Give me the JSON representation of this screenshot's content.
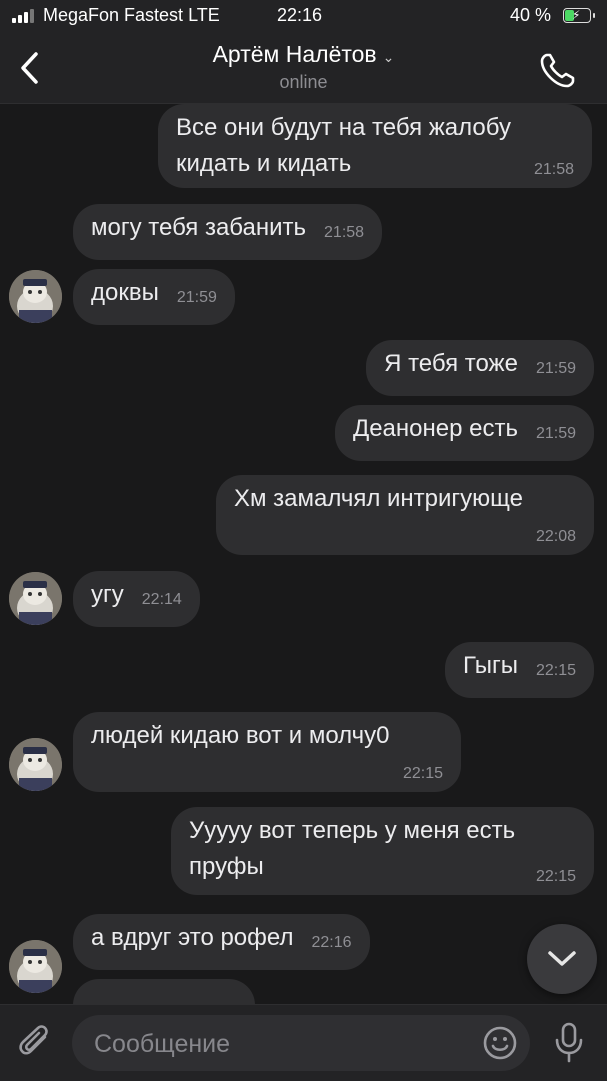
{
  "status_bar": {
    "carrier": "MegaFon Fastest LTE",
    "time": "22:16",
    "battery_percent": "40 %",
    "battery_level": 0.4
  },
  "header": {
    "name": "Артём Налётов",
    "status": "online",
    "icons": {
      "back": "chevron-left-icon",
      "dropdown": "chevron-down-icon",
      "call": "phone-icon"
    }
  },
  "messages": [
    {
      "direction": "out",
      "text": "Все они будут на тебя жалобу кидать и кидать",
      "line1": "Все они будут на тебя жалобу",
      "line2": "кидать и кидать",
      "time": "21:58"
    },
    {
      "direction": "in",
      "text": "могу тебя забанить",
      "time": "21:58"
    },
    {
      "direction": "in",
      "text": "доквы",
      "time": "21:59"
    },
    {
      "direction": "out",
      "text": "Я тебя тоже",
      "time": "21:59"
    },
    {
      "direction": "out",
      "text": "Деанонер есть",
      "time": "21:59"
    },
    {
      "direction": "out",
      "text": "Хм замалчял интригующе",
      "time": "22:08"
    },
    {
      "direction": "in",
      "text": "угу",
      "time": "22:14"
    },
    {
      "direction": "out",
      "text": "Гыгы",
      "time": "22:15"
    },
    {
      "direction": "in",
      "text": "людей кидаю вот и молчу0",
      "time": "22:15"
    },
    {
      "direction": "out",
      "text": "Ууууу вот теперь у меня есть пруфы",
      "line1": "Ууууу вот теперь у меня есть",
      "line2": "пруфы",
      "time": "22:15"
    },
    {
      "direction": "in",
      "text": "а вдруг это рофел",
      "time": "22:16"
    }
  ],
  "input": {
    "placeholder": "Сообщение",
    "value": ""
  },
  "colors": {
    "background": "#19191a",
    "bar": "#232325",
    "bubble": "#2e2e30",
    "battery": "#4cd964"
  }
}
